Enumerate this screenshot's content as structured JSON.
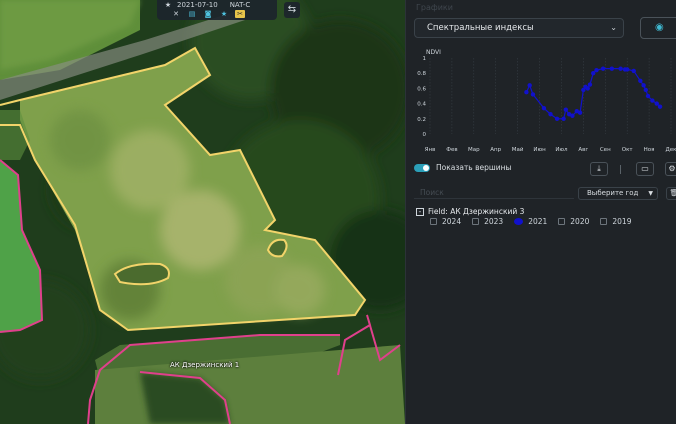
{
  "map": {
    "toolbar": {
      "date": "2021-07-10",
      "source": "NAT-C",
      "icons": [
        "star-icon",
        "shuffle-icon",
        "layers-icon",
        "camera-icon",
        "favorite-icon",
        "crop-icon"
      ]
    },
    "field_label": "АК Дзержинский 1"
  },
  "panel": {
    "section_title": "Графики",
    "dropdown_value": "Спектральные индексы",
    "show_peaks_label": "Показать вершины",
    "search_placeholder": "Поиск",
    "year_select_placeholder": "Выберите год",
    "field_name": "Field: АК Дзержинский 3",
    "years": [
      {
        "label": "2024",
        "checked": false
      },
      {
        "label": "2023",
        "checked": false
      },
      {
        "label": "2021",
        "checked": true
      },
      {
        "label": "2020",
        "checked": false
      },
      {
        "label": "2019",
        "checked": false
      }
    ],
    "colors": {
      "accent": "#2b9fb8",
      "series": "#1111cc",
      "field_outline": "#f2d46a",
      "neighbor_outline": "#e0408c"
    }
  },
  "chart_data": {
    "type": "line",
    "ylabel": "NDVI",
    "ylim": [
      0,
      1
    ],
    "yticks": [
      "0",
      "0.2",
      "0.4",
      "0.6",
      "0.8",
      "1"
    ],
    "categories": [
      "Янв",
      "Фев",
      "Мар",
      "Апр",
      "Май",
      "Июн",
      "Июл",
      "Авг",
      "Сен",
      "Окт",
      "Ноя",
      "Дек"
    ],
    "series": [
      {
        "x": [
          4.4,
          4.55,
          4.7,
          5.2,
          5.5,
          5.8,
          6.1,
          6.2,
          6.35,
          6.5,
          6.7,
          6.85,
          7.0,
          7.1,
          7.2,
          7.3,
          7.45,
          7.6,
          7.9,
          8.3,
          8.7,
          8.9,
          9.0,
          9.3,
          9.6,
          9.75,
          9.85,
          9.95,
          10.15,
          10.35,
          10.5
        ],
        "y": [
          0.55,
          0.64,
          0.52,
          0.34,
          0.26,
          0.2,
          0.2,
          0.32,
          0.26,
          0.24,
          0.3,
          0.28,
          0.58,
          0.62,
          0.6,
          0.65,
          0.8,
          0.84,
          0.86,
          0.86,
          0.86,
          0.85,
          0.85,
          0.83,
          0.7,
          0.64,
          0.58,
          0.5,
          0.44,
          0.4,
          0.36
        ]
      }
    ]
  }
}
